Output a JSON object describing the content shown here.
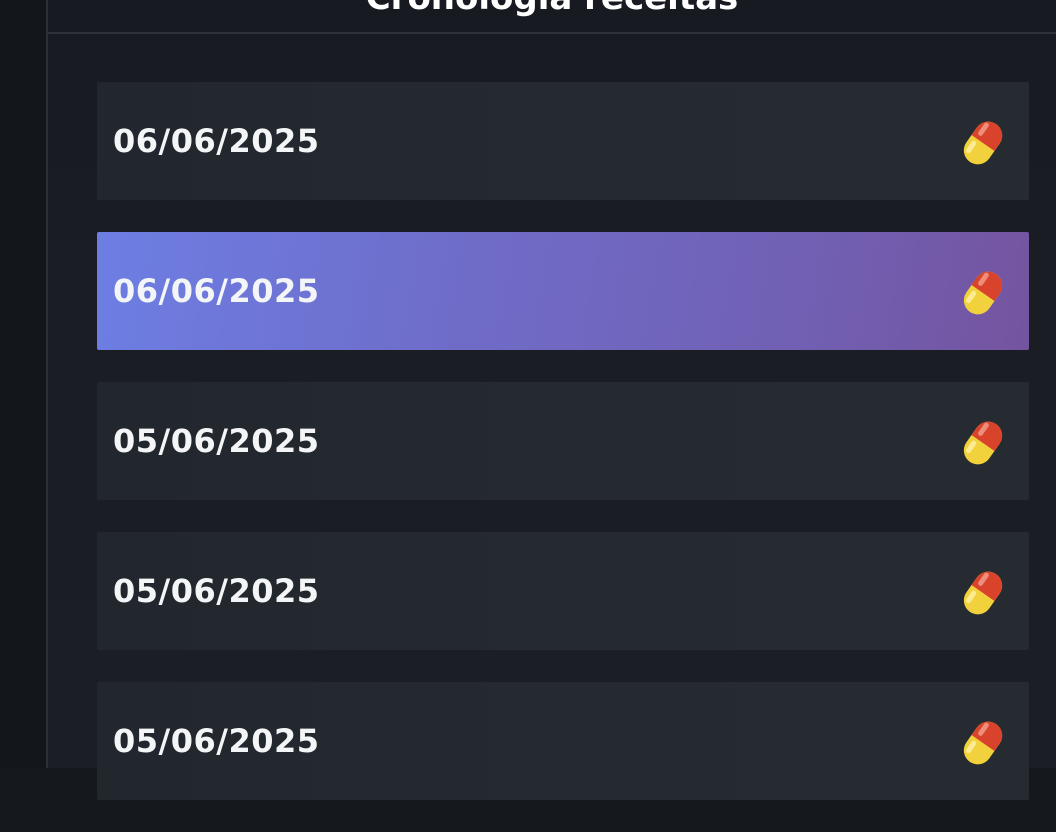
{
  "header": {
    "title": "Cronologia receitas"
  },
  "list": {
    "items": [
      {
        "date": "06/06/2025",
        "icon": "pill-icon",
        "selected": false
      },
      {
        "date": "06/06/2025",
        "icon": "pill-icon",
        "selected": true
      },
      {
        "date": "05/06/2025",
        "icon": "pill-icon",
        "selected": false
      },
      {
        "date": "05/06/2025",
        "icon": "pill-icon",
        "selected": false
      },
      {
        "date": "05/06/2025",
        "icon": "pill-icon",
        "selected": false
      }
    ]
  },
  "colors": {
    "background": "#15181d",
    "item_background": "#23272e",
    "selected_gradient_start": "#6d7ee3",
    "selected_gradient_end": "#74549f",
    "text": "#ffffff"
  }
}
